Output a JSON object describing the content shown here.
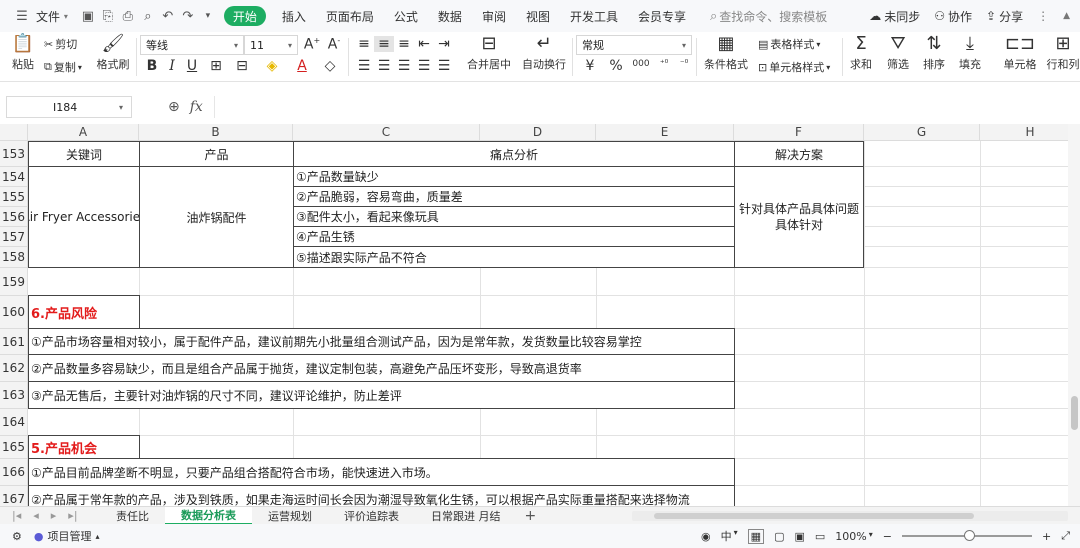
{
  "menubar": {
    "file": "文件",
    "tabs": [
      "开始",
      "插入",
      "页面布局",
      "公式",
      "数据",
      "审阅",
      "视图",
      "开发工具",
      "会员专享"
    ],
    "search_placeholder": "查找命令、搜索模板",
    "unsynced": "未同步",
    "collab": "协作",
    "share": "分享"
  },
  "ribbon": {
    "paste": "粘贴",
    "cut": "剪切",
    "copy": "复制",
    "format_painter": "格式刷",
    "font_name": "等线",
    "font_size": "11",
    "merge_center": "合并居中",
    "wrap_text": "自动换行",
    "number_format": "常规",
    "cond_format": "条件格式",
    "table_style": "表格样式",
    "cell_style": "单元格样式",
    "sum": "求和",
    "filter": "筛选",
    "sort": "排序",
    "fill": "填充",
    "cell": "单元格",
    "row_col": "行和列",
    "bold": "B",
    "italic": "I",
    "underline": "U",
    "currency": "¥",
    "percent": "%",
    "thousands": "000"
  },
  "formula": {
    "cell_ref": "I184",
    "value": ""
  },
  "columns": [
    "A",
    "B",
    "C",
    "D",
    "E",
    "F",
    "G",
    "H"
  ],
  "rows": [
    "153",
    "154",
    "155",
    "156",
    "157",
    "158",
    "159",
    "160",
    "161",
    "162",
    "163",
    "164",
    "165",
    "166",
    "167"
  ],
  "table": {
    "h_keyword": "关键词",
    "h_product": "产品",
    "h_pain": "痛点分析",
    "h_solution": "解决方案",
    "keyword": "Air Fryer Accessories",
    "product": "油炸锅配件",
    "pains": [
      "①产品数量缺少",
      "②产品脆弱，容易弯曲，质量差",
      "③配件太小，看起来像玩具",
      "④产品生锈",
      "⑤描述跟实际产品不符合"
    ],
    "solution": "针对具体产品具体问题具体针对"
  },
  "risk": {
    "title": "6.产品风险",
    "items": [
      "①产品市场容量相对较小，属于配件产品，建议前期先小批量组合测试产品，因为是常年款，发货数量比较容易掌控",
      "②产品数量多容易缺少，而且是组合产品属于抛货，建议定制包装，高避免产品压坏变形，导致高退货率",
      "③产品无售后，主要针对油炸锅的尺寸不同，建议评论维护，防止差评"
    ]
  },
  "opportunity": {
    "title": "5.产品机会",
    "items": [
      "①产品目前品牌垄断不明显，只要产品组合搭配符合市场，能快速进入市场。",
      "②产品属于常年款的产品，涉及到铁质，如果走海运时间长会因为潮湿导致氧化生锈，可以根据产品实际重量搭配来选择物流"
    ]
  },
  "sheets": [
    "责任比",
    "数据分析表",
    "运营规划",
    "评价追踪表",
    "日常跟进 月结"
  ],
  "active_sheet": "数据分析表",
  "status": {
    "project": "项目管理",
    "input_mode": "中",
    "zoom": "100%"
  },
  "colors": {
    "accent": "#1dad62",
    "risk_title": "#e31b1b"
  }
}
